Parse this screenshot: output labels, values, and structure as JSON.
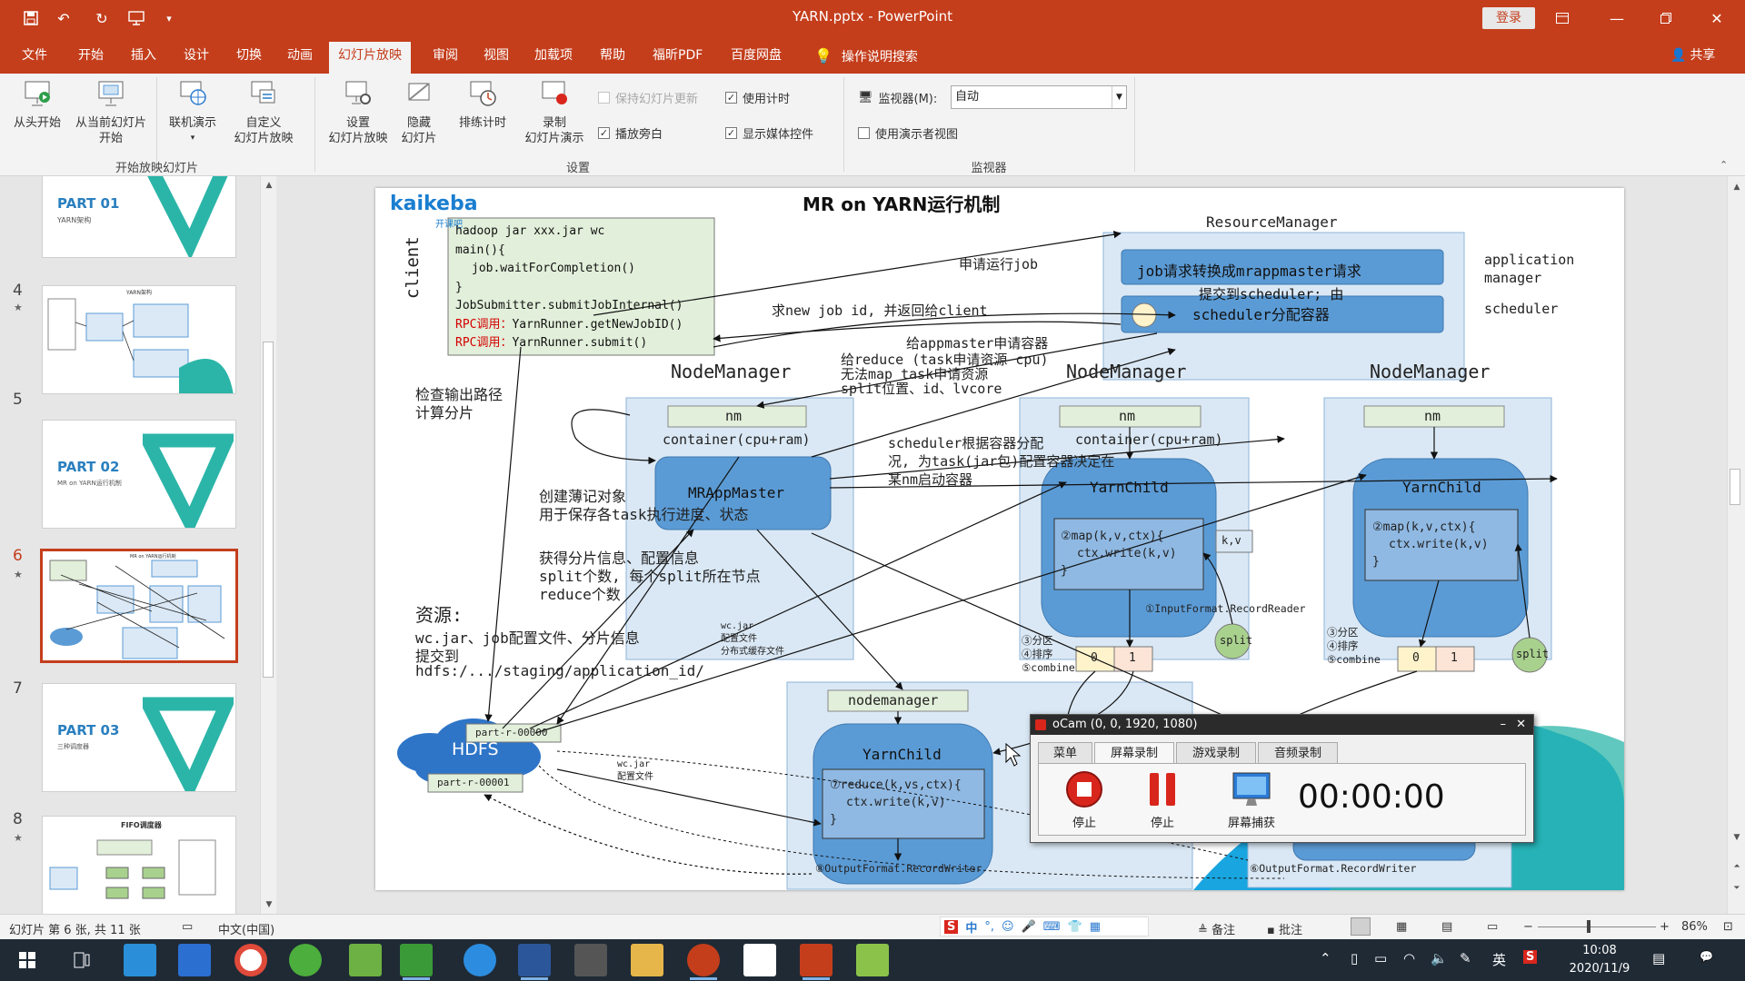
{
  "titlebar": {
    "title": "YARN.pptx  -  PowerPoint",
    "login": "登录"
  },
  "tabs": [
    "文件",
    "开始",
    "插入",
    "设计",
    "切换",
    "动画",
    "幻灯片放映",
    "审阅",
    "视图",
    "加载项",
    "帮助",
    "福昕PDF",
    "百度网盘"
  ],
  "active_tab": "幻灯片放映",
  "tell_me": "操作说明搜索",
  "share": "共享",
  "ribbon": {
    "start": {
      "from_beginning": "从头开始",
      "from_current_1": "从当前幻灯片",
      "from_current_2": "开始",
      "online_1": "联机演示",
      "custom_1": "自定义",
      "custom_2": "幻灯片放映",
      "group": "开始放映幻灯片"
    },
    "setup": {
      "set_up_1": "设置",
      "set_up_2": "幻灯片放映",
      "hide_1": "隐藏",
      "hide_2": "幻灯片",
      "rehearse": "排练计时",
      "record_1": "录制",
      "record_2": "幻灯片演示",
      "keep_updated": "保持幻灯片更新",
      "use_timings": "使用计时",
      "play_narrations": "播放旁白",
      "show_media": "显示媒体控件",
      "group": "设置"
    },
    "monitors": {
      "monitor_label": "监视器(M):",
      "monitor_value": "自动",
      "presenter_view": "使用演示者视图",
      "group": "监视器"
    }
  },
  "thumbnails": [
    {
      "num": "",
      "title": "PART 01",
      "sub": "YARN架构"
    },
    {
      "num": "4",
      "title": "YARN架构",
      "sub": ""
    },
    {
      "num": "5",
      "title": "PART 02",
      "sub": "MR on YARN运行机制"
    },
    {
      "num": "6",
      "title": "MR on YARN运行机制",
      "sub": ""
    },
    {
      "num": "7",
      "title": "PART 03",
      "sub": "三种调度器"
    },
    {
      "num": "8",
      "title": "FIFO调度器",
      "sub": ""
    }
  ],
  "star": "★",
  "slide": {
    "logo": "kaikeba",
    "logo_sub": "开课吧",
    "title": "MR on YARN运行机制",
    "client": "client",
    "code_lines": [
      "hadoop jar xxx.jar wc",
      "main(){",
      "  job.waitForCompletion()",
      "}",
      "JobSubmitter.submitJobInternal()"
    ],
    "code_rpc": [
      {
        "prefix": "RPC调用：",
        "body": "YarnRunner.getNewJobID()"
      },
      {
        "prefix": "RPC调用：",
        "body": "YarnRunner.submit()"
      }
    ],
    "rm_title": "ResourceManager",
    "rm_box1": "job请求转换成mrappmaster请求",
    "rm_box2": "scheduler分配容器",
    "rm_overlap": "提交到scheduler; 由",
    "rm_label_app1": "application",
    "rm_label_app2": "manager",
    "rm_label_sched": "scheduler",
    "apply_job": "申请运行job",
    "new_job_id": "求new job id, 并返回给client",
    "appmaster_apply": "给appmaster申请容器",
    "reduce_apply": "给reduce (task申请资源  cpu)",
    "map_apply": "无法map task申请资源",
    "split_loc": "split位置、id、lvcore",
    "nm1": "NodeManager",
    "nm2": "NodeManager",
    "nm3": "NodeManager",
    "nm_small": "nm",
    "container": "container(cpu+ram)",
    "container2": "container(cpu+ram)",
    "mrappmaster": "MRAppMaster",
    "scheduler_alloc": "scheduler根据容器分配",
    "overlap2": "况, 为task(jar包)配置容器决定在",
    "start_container": "某nm启动容器",
    "check_output_1": "检查输出路径",
    "check_output_2": "计算分片",
    "create_book_1": "创建薄记对象",
    "create_book_2": "用于保存各task执行进度、状态",
    "get_split_1": "获得分片信息、配置信息",
    "get_split_2": "split个数, 每个split所在节点",
    "get_split_3": "reduce个数",
    "resource_1": "资源:",
    "resource_2": "wc.jar、job配置文件、分片信息",
    "resource_3": "提交到",
    "resource_4": "hdfs:/.../staging/application_id/",
    "hdfs": "HDFS",
    "part0": "part-r-00000",
    "part1": "part-r-00001",
    "wcjar_1": "wc.jar",
    "wcjar_2": "配置文件",
    "wcjar_3": "分布式缓存文件",
    "wcjar_b1": "wc.jar",
    "wcjar_b2": "配置文件",
    "yarnchild": "YarnChild",
    "map_code_1": "②map(k,v,ctx){",
    "map_code_2": "ctx.write(k,v)",
    "map_code_3": "}",
    "kv": "k,v",
    "input_format": "①InputFormat.RecordReader",
    "split": "split",
    "partition": "③分区",
    "sort": "④排序",
    "combine": "⑤combine",
    "zero": "0",
    "one": "1",
    "nodemanager_small": "nodemanager",
    "reduce_code_1": "⑦reduce(k,vs,ctx){",
    "reduce_code_2": "ctx.write(k,v)",
    "reduce_code_3": "}",
    "output_format": "⑧OutputFormat.RecordWriter",
    "output_format2": "⑥OutputFormat.RecordWriter"
  },
  "ocam": {
    "title": "oCam (0, 0, 1920, 1080)",
    "tabs": [
      "菜单",
      "屏幕录制",
      "游戏录制",
      "音频录制"
    ],
    "btn_stop1": "停止",
    "btn_stop2": "停止",
    "btn_capture": "屏幕捕获",
    "timer": "00:00:00"
  },
  "status": {
    "slide_info": "幻灯片 第 6 张, 共 11 张",
    "language": "中文(中国)",
    "notes": "备注",
    "comments": "批注",
    "zoom": "86%"
  },
  "taskbar": {
    "time": "10:08",
    "date": "2020/11/9",
    "ime": "英"
  },
  "colors": {
    "accent": "#c43e1c",
    "code_bg": "#e2efda",
    "box_blue": "#5b9bd5",
    "panel_blue": "#dae8f5"
  }
}
